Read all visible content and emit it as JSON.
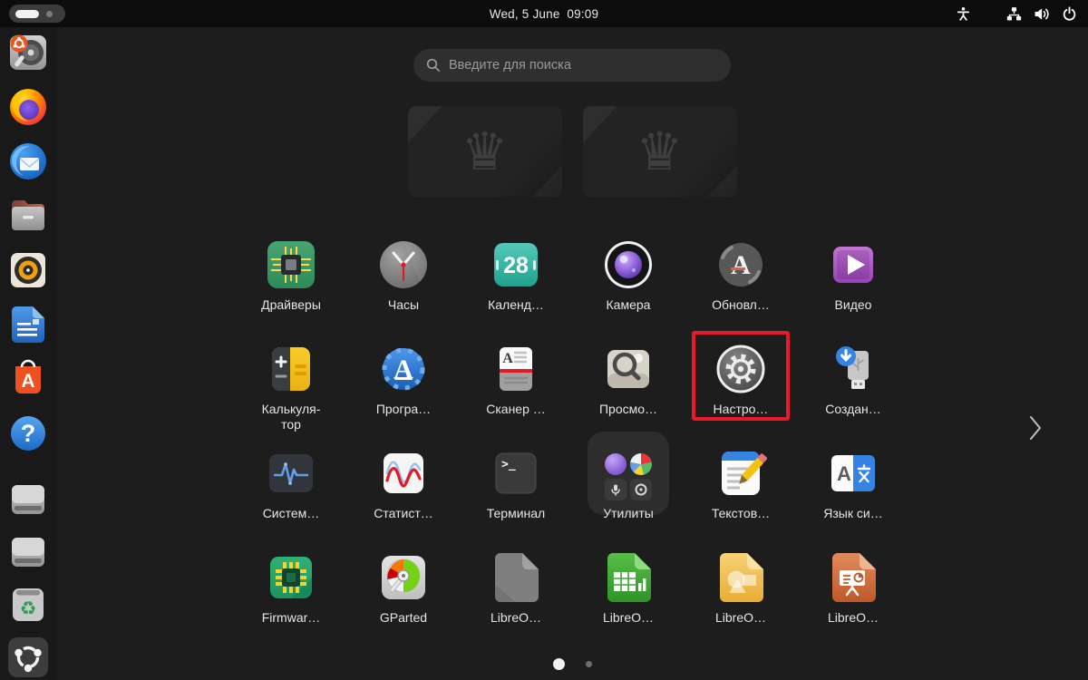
{
  "topbar": {
    "clock": "Wed, 5 June  09:09",
    "workspace_indicator": {
      "workspaces": 2,
      "active": 1
    },
    "tray_icons": [
      "accessibility",
      "network-wired",
      "volume",
      "power"
    ]
  },
  "search": {
    "placeholder": "Введите для поиска",
    "icon": "search-icon"
  },
  "workspaces": [
    {
      "name": "workspace-1"
    },
    {
      "name": "workspace-2"
    }
  ],
  "dock": {
    "items": [
      {
        "name": "ubuntu-installer"
      },
      {
        "name": "firefox"
      },
      {
        "name": "thunderbird"
      },
      {
        "name": "files"
      },
      {
        "name": "rhythmbox"
      },
      {
        "name": "libreoffice-writer"
      },
      {
        "name": "app-center"
      },
      {
        "name": "help"
      },
      {
        "name": "drive-1"
      },
      {
        "name": "drive-2"
      },
      {
        "name": "trash"
      },
      {
        "name": "show-apps"
      }
    ]
  },
  "apps": [
    {
      "label": "Драйверы",
      "icon": "drivers-chip-icon"
    },
    {
      "label": "Часы",
      "icon": "clock-icon"
    },
    {
      "label": "Календ…",
      "icon": "calendar-icon",
      "day": "28"
    },
    {
      "label": "Камера",
      "icon": "camera-lens-icon"
    },
    {
      "label": "Обновл…",
      "icon": "software-updater-icon"
    },
    {
      "label": "Видео",
      "icon": "video-player-icon"
    },
    {
      "label": "Калькуля-\nтор",
      "icon": "calculator-icon"
    },
    {
      "label": "Програ…",
      "icon": "software-store-icon"
    },
    {
      "label": "Сканер …",
      "icon": "document-scanner-icon"
    },
    {
      "label": "Просмо…",
      "icon": "image-viewer-icon"
    },
    {
      "label": "Настро…",
      "icon": "settings-gear-icon",
      "highlighted": true
    },
    {
      "label": "Создан…",
      "icon": "startup-disk-creator-icon"
    },
    {
      "label": "Систем…",
      "icon": "system-monitor-icon"
    },
    {
      "label": "Статист…",
      "icon": "usage-stats-icon"
    },
    {
      "label": "Терминал",
      "icon": "terminal-icon",
      "prompt": ">_"
    },
    {
      "label": "Утилиты",
      "icon": "utilities-folder-icon"
    },
    {
      "label": "Текстов…",
      "icon": "text-editor-icon"
    },
    {
      "label": "Язык си…",
      "icon": "language-support-icon",
      "letter": "A"
    },
    {
      "label": "Firmwar…",
      "icon": "firmware-chip-icon"
    },
    {
      "label": "GParted",
      "icon": "gparted-disk-icon"
    },
    {
      "label": "LibreO…",
      "icon": "libreoffice-startcenter-icon"
    },
    {
      "label": "LibreO…",
      "icon": "libreoffice-calc-icon"
    },
    {
      "label": "LibreO…",
      "icon": "libreoffice-draw-icon"
    },
    {
      "label": "LibreO…",
      "icon": "libreoffice-impress-icon"
    }
  ],
  "glyphs": {
    "calendar_day": "28",
    "terminal_prompt": ">_",
    "updater_letter": "A",
    "store_letter": "A",
    "help_mark": "?",
    "appcenter_letter": "A",
    "language_letter": "A"
  },
  "annotation": {
    "type": "highlight-box",
    "color": "#e8192c",
    "target": "Настро…"
  },
  "pager": {
    "pages": 2,
    "active_page": 1
  }
}
